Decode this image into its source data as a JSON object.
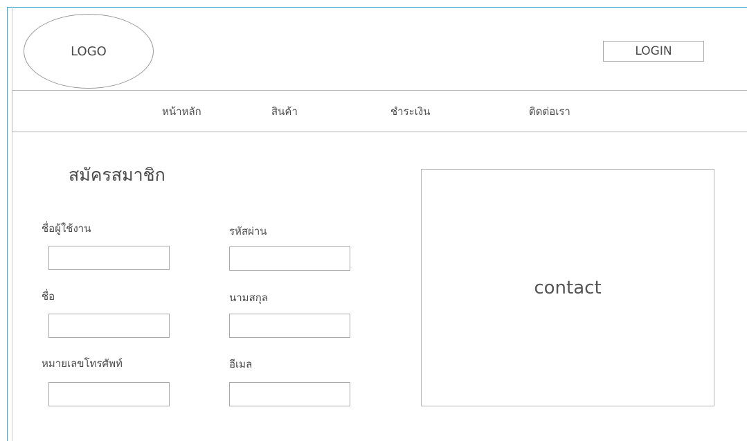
{
  "header": {
    "logo_text": "LOGO",
    "login_label": "LOGIN"
  },
  "nav": {
    "items": [
      {
        "label": "หน้าหลัก"
      },
      {
        "label": "สินค้า"
      },
      {
        "label": "ชำระเงิน"
      },
      {
        "label": "ติดต่อเรา"
      }
    ]
  },
  "form": {
    "title": "สมัครสมาชิก",
    "fields": [
      {
        "label": "ชื่อผู้ใช้งาน",
        "value": "",
        "placeholder": ""
      },
      {
        "label": "รหัสผ่าน",
        "value": "",
        "placeholder": ""
      },
      {
        "label": "ชื่อ",
        "value": "",
        "placeholder": ""
      },
      {
        "label": "นามสกุล",
        "value": "",
        "placeholder": ""
      },
      {
        "label": "หมายเลขโทรศัพท์",
        "value": "",
        "placeholder": ""
      },
      {
        "label": "อีเมล",
        "value": "",
        "placeholder": ""
      }
    ]
  },
  "contact": {
    "label": "contact"
  },
  "colors": {
    "frame_accent": "#3fa6d6",
    "border_gray": "#b4b4b4",
    "text_gray": "#4a4a4a"
  }
}
